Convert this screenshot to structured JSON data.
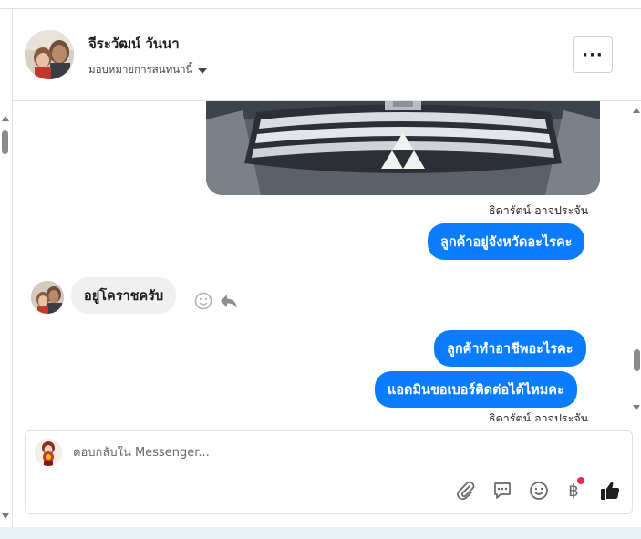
{
  "header": {
    "contact_name": "จีระวัฒน์ วันนา",
    "assign_label": "มอบหมายการสนทนานี้",
    "more_label": "···"
  },
  "messages": {
    "sender_top": "ธิดารัตน์ อาจประจัน",
    "out1": "ลูกค้าอยู่จังหวัดอะไรคะ",
    "in1": "อยู่โคราชครับ",
    "out2": "ลูกค้าทำอาชีพอะไรคะ",
    "out3": "แอดมินขอเบอร์ติดต่อได้ไหมคะ",
    "sender_bottom": "ธิดารัตน์ อาจประจัน"
  },
  "composer": {
    "placeholder": "ตอบกลับใน Messenger...",
    "currency_symbol": "฿"
  },
  "colors": {
    "accent": "#0a7cff",
    "incoming_bubble": "#f0f0f0",
    "notification_dot": "#f02849"
  },
  "icons": [
    "more-icon",
    "caret-down-icon",
    "emoji-react-icon",
    "reply-icon",
    "paperclip-icon",
    "saved-replies-icon",
    "emoji-icon",
    "baht-icon",
    "like-icon"
  ]
}
